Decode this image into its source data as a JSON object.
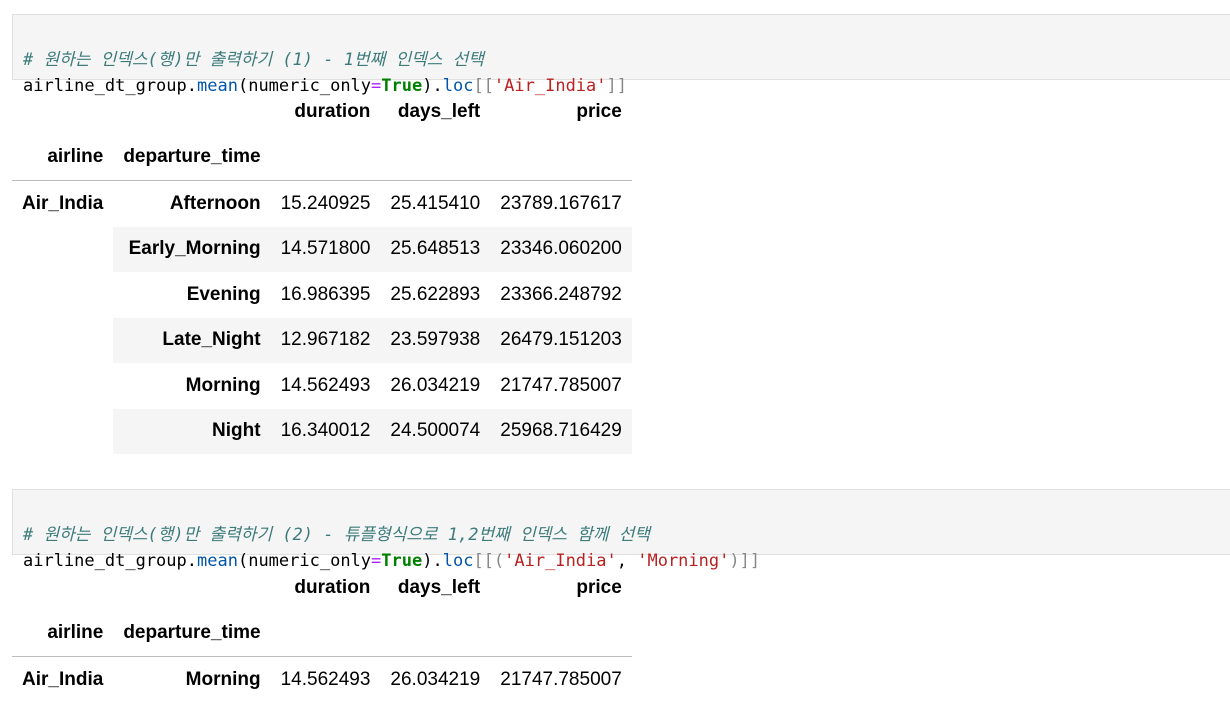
{
  "cell1": {
    "comment": "# 원하는 인덱스(행)만 출력하기 (1) - 1번째 인덱스 선택",
    "code": {
      "obj": "airline_dt_group.",
      "method": "mean",
      "open_paren": "(",
      "arg_name": "numeric_only",
      "equals": "=",
      "arg_value": "True",
      "close_dot": ").",
      "accessor": "loc",
      "open_brackets": "[[",
      "key": "'Air_India'",
      "close_brackets": "]]"
    }
  },
  "table1": {
    "columns": [
      "duration",
      "days_left",
      "price"
    ],
    "index_names": [
      "airline",
      "departure_time"
    ],
    "airline": "Air_India",
    "rows": [
      {
        "departure_time": "Afternoon",
        "duration": "15.240925",
        "days_left": "25.415410",
        "price": "23789.167617"
      },
      {
        "departure_time": "Early_Morning",
        "duration": "14.571800",
        "days_left": "25.648513",
        "price": "23346.060200"
      },
      {
        "departure_time": "Evening",
        "duration": "16.986395",
        "days_left": "25.622893",
        "price": "23366.248792"
      },
      {
        "departure_time": "Late_Night",
        "duration": "12.967182",
        "days_left": "23.597938",
        "price": "26479.151203"
      },
      {
        "departure_time": "Morning",
        "duration": "14.562493",
        "days_left": "26.034219",
        "price": "21747.785007"
      },
      {
        "departure_time": "Night",
        "duration": "16.340012",
        "days_left": "24.500074",
        "price": "25968.716429"
      }
    ]
  },
  "cell2": {
    "comment": "# 원하는 인덱스(행)만 출력하기 (2) - 튜플형식으로 1,2번째 인덱스 함께 선택",
    "code": {
      "obj": "airline_dt_group.",
      "method": "mean",
      "open_paren": "(",
      "arg_name": "numeric_only",
      "equals": "=",
      "arg_value": "True",
      "close_dot": ").",
      "accessor": "loc",
      "open_brackets": "[[(",
      "key1": "'Air_India'",
      "sep": ", ",
      "key2": "'Morning'",
      "close_brackets": ")]]"
    }
  },
  "table2": {
    "columns": [
      "duration",
      "days_left",
      "price"
    ],
    "index_names": [
      "airline",
      "departure_time"
    ],
    "airline": "Air_India",
    "rows": [
      {
        "departure_time": "Morning",
        "duration": "14.562493",
        "days_left": "26.034219",
        "price": "21747.785007"
      }
    ]
  }
}
